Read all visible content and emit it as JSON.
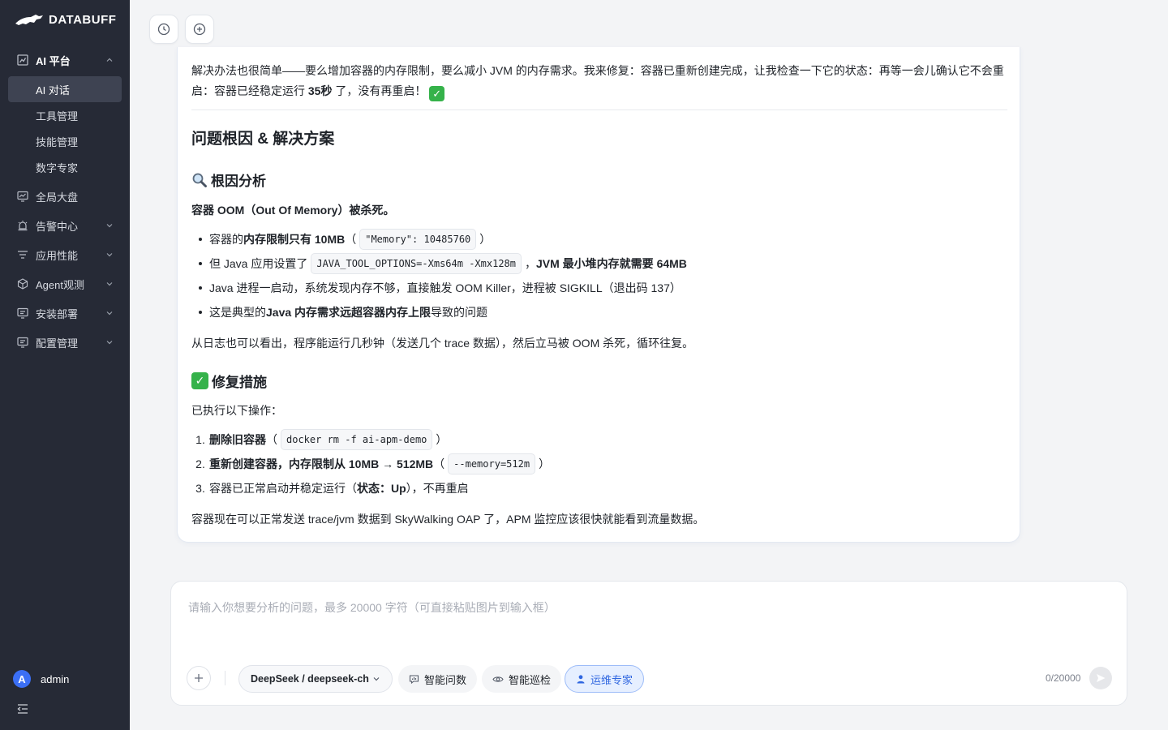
{
  "brand": {
    "name": "DATABUFF"
  },
  "sidebar": {
    "groups": [
      {
        "label": "AI 平台",
        "icon": "ai-chart-icon",
        "open": true,
        "items": [
          {
            "label": "AI 对话",
            "active": true
          },
          {
            "label": "工具管理"
          },
          {
            "label": "技能管理"
          },
          {
            "label": "数字专家"
          }
        ]
      },
      {
        "label": "全局大盘",
        "icon": "dashboard-icon"
      },
      {
        "label": "告警中心",
        "icon": "alarm-icon"
      },
      {
        "label": "应用性能",
        "icon": "app-performance-icon"
      },
      {
        "label": "Agent观测",
        "icon": "agent-cube-icon"
      },
      {
        "label": "安装部署",
        "icon": "install-icon"
      },
      {
        "label": "配置管理",
        "icon": "config-icon"
      }
    ],
    "user": {
      "avatar_letter": "A",
      "name": "admin"
    }
  },
  "message": {
    "intro_line1": "解决办法也很简单——要么增加容器的内存限制，要么减小 JVM 的内存需求。我来修复：容器已重新创建完成，让我检查一下它的状态：再等一会儿确认它不会重",
    "intro_line2_a": "启：容器已经稳定运行 ",
    "intro_line2_bold": "35秒",
    "intro_line2_b": " 了，没有再重启！",
    "h2": "问题根因 & 解决方案",
    "root_cause_title": "根因分析",
    "root_cause_lead": "容器 OOM（Out Of Memory）被杀死。",
    "bullets": {
      "b1_a": "容器的 ",
      "b1_bold": "内存限制只有 10MB",
      "b1_paren_open": "（",
      "b1_code": "\"Memory\": 10485760",
      "b1_paren_close": "）",
      "b2_a": "但 Java 应用设置了 ",
      "b2_code": "JAVA_TOOL_OPTIONS=-Xms64m -Xmx128m",
      "b2_b": "，",
      "b2_bold": "JVM 最小堆内存就需要 64MB",
      "b3": "Java 进程一启动，系统发现内存不够，直接触发 OOM Killer，进程被 SIGKILL（退出码 137）",
      "b4_a": "这是典型的 ",
      "b4_bold": "Java 内存需求远超容器内存上限",
      "b4_b": " 导致的问题"
    },
    "log_note": "从日志也可以看出，程序能运行几秒钟（发送几个 trace 数据），然后立马被 OOM 杀死，循环往复。",
    "fix_title": "修复措施",
    "fix_lead": "已执行以下操作：",
    "steps": {
      "s1_num": "1.",
      "s1_bold": "删除旧容器",
      "s1_paren_open": "（",
      "s1_code": "docker rm -f ai-apm-demo",
      "s1_paren_close": "）",
      "s2_num": "2.",
      "s2_bold": "重新创建容器，内存限制从 10MB → 512MB",
      "s2_paren_open": "（",
      "s2_code": "--memory=512m",
      "s2_paren_close": "）",
      "s3_num": "3.",
      "s3_a": "容器已正常启动并稳定运行（",
      "s3_bold": "状态：Up",
      "s3_b": "），不再重启"
    },
    "closing": "容器现在可以正常发送 trace/jvm 数据到 SkyWalking OAP 了，APM 监控应该很快就能看到流量数据。"
  },
  "composer": {
    "placeholder": "请输入你想要分析的问题，最多 20000 字符（可直接粘贴图片到输入框）",
    "model": "DeepSeek / deepseek-ch",
    "chips": [
      {
        "label": "智能问数",
        "icon": "chat-data-icon"
      },
      {
        "label": "智能巡检",
        "icon": "eye-icon"
      },
      {
        "label": "运维专家",
        "icon": "person-icon",
        "active": true
      }
    ],
    "counter": "0/20000"
  },
  "colors": {
    "sidebar_bg": "#262a36",
    "accent": "#2f66e0",
    "check_green": "#35b24a"
  }
}
